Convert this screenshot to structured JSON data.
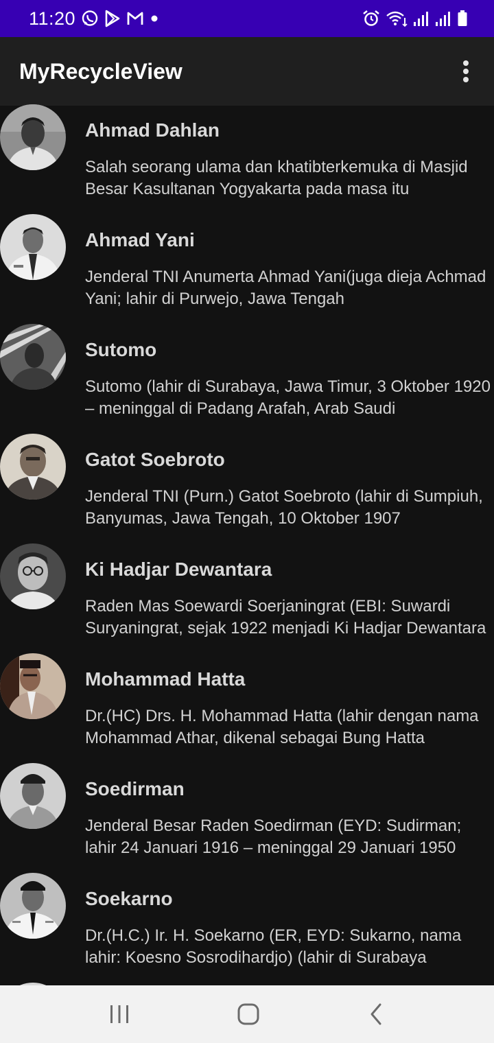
{
  "status_bar": {
    "time": "11:20",
    "left_icons": [
      "whatsapp-icon",
      "play-store-icon",
      "gmail-icon",
      "notification-dot-icon"
    ],
    "right_icons": [
      "alarm-icon",
      "wifi-icon",
      "signal-icon",
      "signal-icon",
      "battery-icon"
    ],
    "color": "#3700b3"
  },
  "app_bar": {
    "title": "MyRecycleView",
    "menu_icon": "more-vert-icon",
    "color": "#1f1f1f"
  },
  "heroes": [
    {
      "name": "Ahmad Dahlan",
      "description": "Salah seorang ulama dan khatibterkemuka di Masjid Besar Kasultanan Yogyakarta pada masa itu"
    },
    {
      "name": "Ahmad Yani",
      "description": "Jenderal TNI Anumerta Ahmad Yani(juga dieja Achmad Yani; lahir di Purwejo, Jawa Tengah"
    },
    {
      "name": "Sutomo",
      "description": "Sutomo (lahir di Surabaya, Jawa Timur, 3 Oktober 1920 – meninggal di Padang Arafah, Arab Saudi"
    },
    {
      "name": "Gatot Soebroto",
      "description": "Jenderal TNI (Purn.) Gatot Soebroto (lahir di Sumpiuh, Banyumas, Jawa Tengah, 10 Oktober 1907"
    },
    {
      "name": "Ki Hadjar Dewantara",
      "description": "Raden Mas Soewardi Soerjaningrat (EBI: Suwardi Suryaningrat, sejak 1922 menjadi Ki Hadjar Dewantara"
    },
    {
      "name": "Mohammad Hatta",
      "description": "Dr.(HC) Drs. H. Mohammad Hatta (lahir dengan nama Mohammad Athar, dikenal sebagai Bung Hatta"
    },
    {
      "name": "Soedirman",
      "description": "Jenderal Besar Raden Soedirman (EYD: Sudirman; lahir 24 Januari 1916 – meninggal 29 Januari 1950"
    },
    {
      "name": "Soekarno",
      "description": "Dr.(H.C.) Ir. H. Soekarno (ER, EYD: Sukarno, nama lahir: Koesno Sosrodihardjo) (lahir di Surabaya"
    }
  ],
  "nav_bar": {
    "buttons": [
      "recent-apps-icon",
      "home-icon",
      "back-icon"
    ]
  },
  "colors": {
    "background": "#121212",
    "text": "#d9d9d9",
    "nav_bar": "#f2f2f2"
  }
}
